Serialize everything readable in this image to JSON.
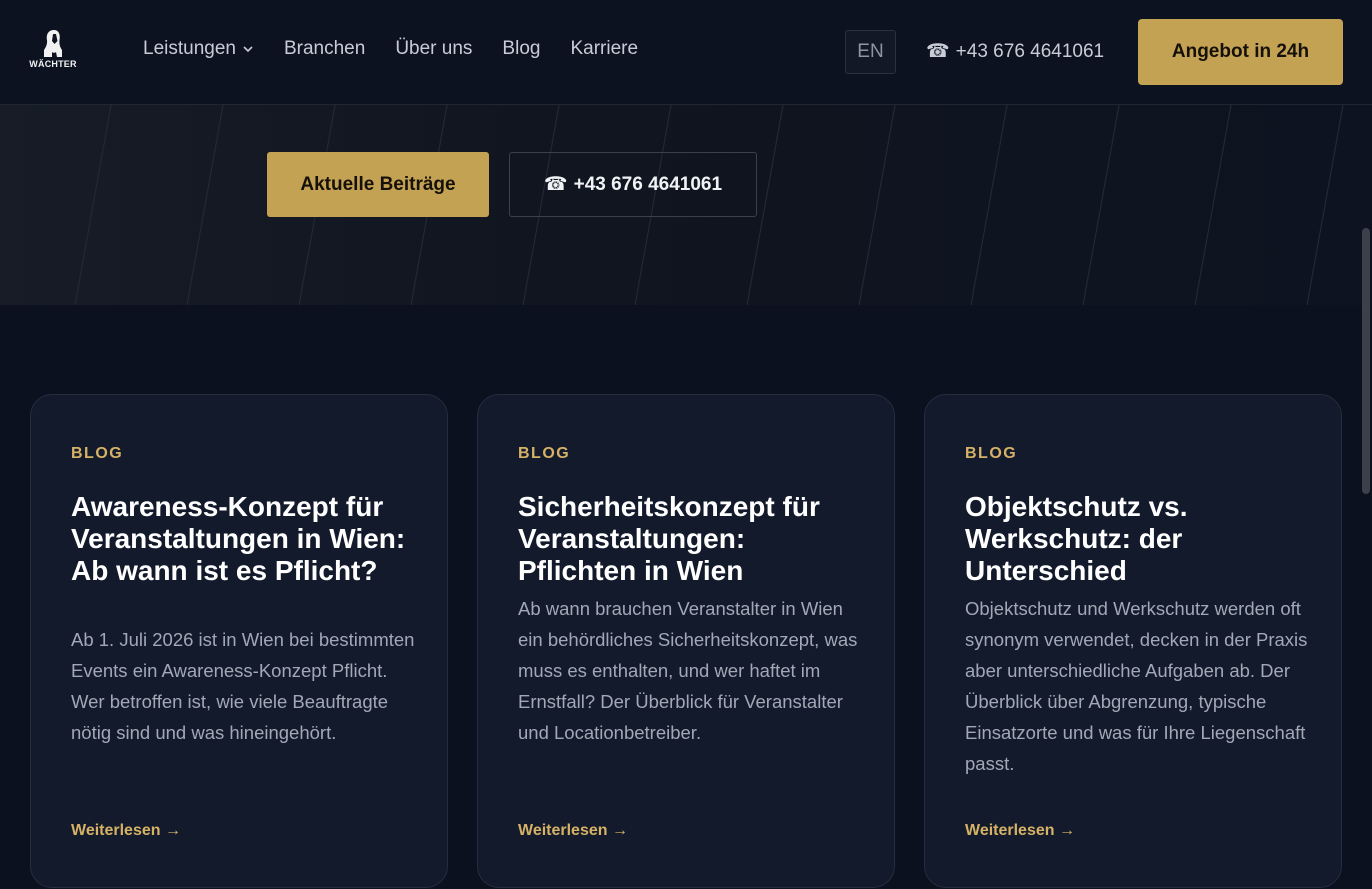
{
  "header": {
    "logo_text": "WÄCHTER",
    "nav": [
      {
        "label": "Leistungen",
        "has_dropdown": true
      },
      {
        "label": "Branchen"
      },
      {
        "label": "Über uns"
      },
      {
        "label": "Blog"
      },
      {
        "label": "Karriere"
      }
    ],
    "lang_label": "EN",
    "phone_icon": "☎",
    "phone": "+43 676 4641061",
    "cta_label": "Angebot in 24h"
  },
  "hero": {
    "primary_label": "Aktuelle Beiträge",
    "secondary_icon": "☎",
    "secondary_label": "+43 676 4641061"
  },
  "cards": [
    {
      "tag": "BLOG",
      "title": "Awareness-Konzept für Veranstaltungen in Wien: Ab wann ist es Pflicht?",
      "text": "Ab 1. Juli 2026 ist in Wien bei be­stimmten Events ein Awareness-Konzept Pflicht. Wer betroffen ist, wie viele Beauftragte nötig sind und was hineingehört.",
      "link": "Weiterlesen →"
    },
    {
      "tag": "BLOG",
      "title": "Sicherheitskonzept für Veranstaltungen: Pflichten in Wien",
      "text": "Ab wann brauchen Veranstalter in Wien ein behördliches Sicherheits­konzept, was muss es enthalten, und wer haftet im Ernstfall? Der Überblick für Veranstalter und Locationbetreiber.",
      "link": "Weiterlesen →"
    },
    {
      "tag": "BLOG",
      "title": "Objektschutz vs. Werkschutz: der Unterschied",
      "text": "Objektschutz und Werkschutz wer­den oft synonym verwendet, decken in der Praxis aber unterschiedliche Aufgaben ab. Der Überblick über Abgrenzung, typische Einsatzorte und was für Ihre Liegenschaft passt.",
      "link": "Weiterlesen →"
    }
  ],
  "colors": {
    "accent": "#c4a253",
    "tag": "#d5b266",
    "background": "#0b111e",
    "card": "#131a2b"
  }
}
